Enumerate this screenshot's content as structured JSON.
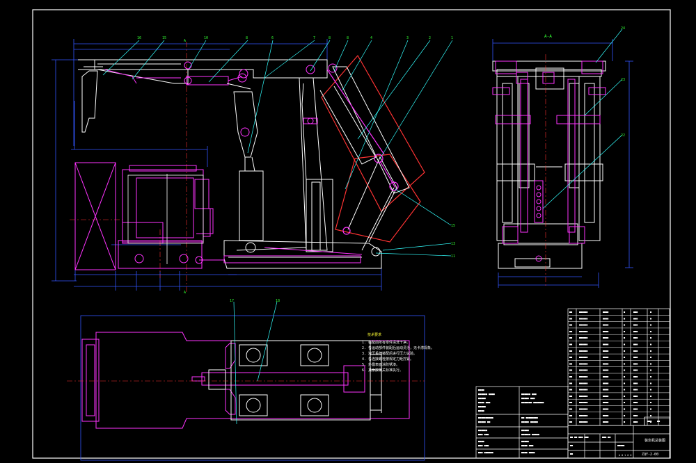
{
  "section_label": "A-A",
  "notes": {
    "title": "技术要求",
    "lines": [
      "1. 装配前所有零件清洗干净。",
      "2. 各运动部件装配后运动灵活，无卡滞现象。",
      "3. 液压系统装配后进行压力试验。",
      "4. 各连接螺栓按规定力矩拧紧。",
      "5. 外露表面涂防锈漆。",
      "6. 其余按相关标准执行。"
    ]
  },
  "title_block": {
    "name": "装岩机总装图",
    "drawing_no": "ZQY-2-00",
    "scale_label": "比例",
    "material_label": "材料"
  },
  "colors": {
    "outline": "#ffffff",
    "magenta": "#ff33ff",
    "red": "#ff3333",
    "cyan": "#33ffff",
    "yellow": "#ffff33",
    "green": "#33ff33",
    "blue": "#3355ff",
    "gray": "#c8c8c8"
  }
}
